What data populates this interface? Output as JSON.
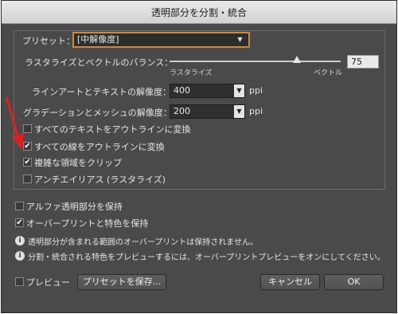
{
  "window": {
    "title": "透明部分を分割・統合"
  },
  "preset": {
    "label": "プリセット：",
    "value": "[中解像度]"
  },
  "balance": {
    "label": "ラスタライズとベクトルのバランス：",
    "left_label": "ラスタライズ",
    "right_label": "ベクトル",
    "value": "75",
    "level_percent": 75
  },
  "line_art": {
    "label": "ラインアートとテキストの解像度：",
    "value": "400",
    "unit": "ppi"
  },
  "gradient": {
    "label": "グラデーションとメッシュの解像度：",
    "value": "200",
    "unit": "ppi"
  },
  "options": [
    {
      "label": "すべてのテキストをアウトラインに変換",
      "checked": false
    },
    {
      "label": "すべての線をアウトラインに変換",
      "checked": true
    },
    {
      "label": "複雑な領域をクリップ",
      "checked": true
    },
    {
      "label": "アンチエイリアス (ラスタライズ)",
      "checked": false
    }
  ],
  "alpha": {
    "label": "アルファ透明部分を保持",
    "checked": false
  },
  "overprint": {
    "label": "オーバープリントと特色を保持",
    "checked": true
  },
  "info": [
    "透明部分が含まれる範囲のオーバープリントは保持されません。",
    "分割・統合される特色をプレビューするには、オーバープリントプレビューをオンにしてください。"
  ],
  "footer": {
    "preview_label": "プレビュー",
    "save_preset": "プリセットを保存...",
    "cancel": "キャンセル",
    "ok": "OK"
  },
  "icons": {
    "check": "✔",
    "info": "i",
    "dropdown": "▼"
  },
  "colors": {
    "dialog_bg": "#4a4a4a",
    "preset_border": "#c98a3a",
    "annotation_arrow": "#e02020"
  }
}
